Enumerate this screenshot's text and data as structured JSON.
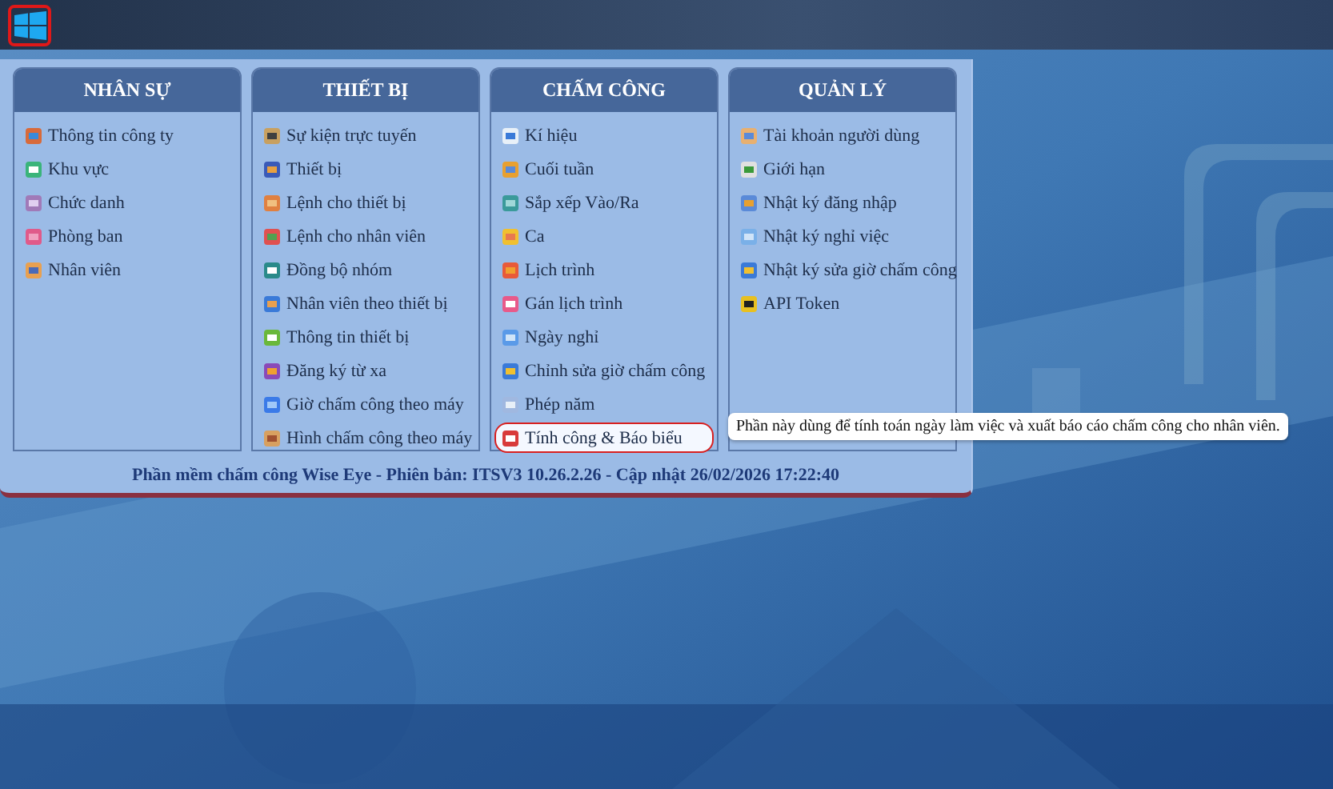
{
  "start_button": {
    "selected": true
  },
  "menu": {
    "columns": [
      {
        "title": "NHÂN SỰ",
        "items": [
          {
            "label": "Thông tin công ty",
            "selected": false
          },
          {
            "label": "Khu vực",
            "selected": false
          },
          {
            "label": "Chức danh",
            "selected": false
          },
          {
            "label": "Phòng ban",
            "selected": false
          },
          {
            "label": "Nhân viên",
            "selected": false
          }
        ]
      },
      {
        "title": "THIẾT BỊ",
        "items": [
          {
            "label": "Sự kiện trực tuyến",
            "selected": false
          },
          {
            "label": "Thiết bị",
            "selected": false
          },
          {
            "label": "Lệnh cho thiết bị",
            "selected": false
          },
          {
            "label": "Lệnh cho nhân viên",
            "selected": false
          },
          {
            "label": "Đồng bộ nhóm",
            "selected": false
          },
          {
            "label": "Nhân viên theo thiết bị",
            "selected": false
          },
          {
            "label": "Thông tin thiết bị",
            "selected": false
          },
          {
            "label": "Đăng ký từ xa",
            "selected": false
          },
          {
            "label": "Giờ chấm công theo máy",
            "selected": false
          },
          {
            "label": "Hình chấm công theo máy",
            "selected": false
          }
        ]
      },
      {
        "title": "CHẤM CÔNG",
        "items": [
          {
            "label": "Kí hiệu",
            "selected": false
          },
          {
            "label": "Cuối tuần",
            "selected": false
          },
          {
            "label": "Sắp xếp Vào/Ra",
            "selected": false
          },
          {
            "label": "Ca",
            "selected": false
          },
          {
            "label": "Lịch trình",
            "selected": false
          },
          {
            "label": "Gán lịch trình",
            "selected": false
          },
          {
            "label": "Ngày nghỉ",
            "selected": false
          },
          {
            "label": "Chỉnh sửa giờ chấm công",
            "selected": false
          },
          {
            "label": "Phép năm",
            "selected": false
          },
          {
            "label": "Tính công & Báo biểu",
            "selected": true
          }
        ]
      },
      {
        "title": "QUẢN LÝ",
        "items": [
          {
            "label": "Tài khoản người dùng",
            "selected": false
          },
          {
            "label": "Giới hạn",
            "selected": false
          },
          {
            "label": "Nhật ký đăng nhập",
            "selected": false
          },
          {
            "label": "Nhật ký nghỉ việc",
            "selected": false
          },
          {
            "label": "Nhật ký sửa giờ chấm công",
            "selected": false
          },
          {
            "label": "API Token",
            "selected": false
          }
        ]
      }
    ],
    "footer": "Phần mềm chấm công Wise Eye - Phiên bản: ITSV3 10.26.2.26 - Cập nhật 26/02/2026 17:22:40"
  },
  "tooltip": "Phần này dùng để tính toán ngày làm việc và xuất báo cáo chấm công cho nhân viên."
}
